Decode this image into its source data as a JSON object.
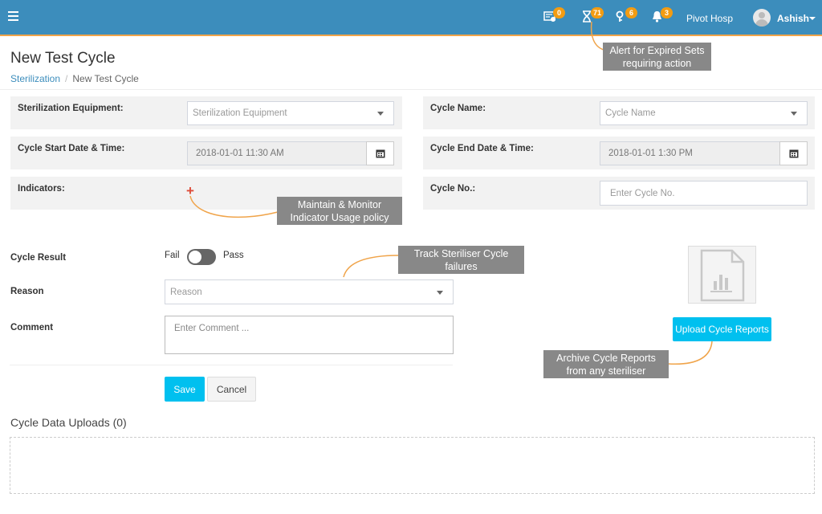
{
  "nav": {
    "badges": {
      "tasks": "0",
      "expired": "71",
      "keys": "6",
      "alerts": "3"
    },
    "org_name": "Pivot Hosp",
    "user_name": "Ashish"
  },
  "page": {
    "title": "New Test Cycle",
    "breadcrumb": {
      "parent": "Sterilization",
      "current": "New Test Cycle"
    }
  },
  "form": {
    "equipment": {
      "label": "Sterilization Equipment:",
      "placeholder": "Sterilization Equipment"
    },
    "cycle_name": {
      "label": "Cycle Name:",
      "placeholder": "Cycle Name"
    },
    "start": {
      "label": "Cycle Start Date & Time:",
      "value": "2018-01-01 11:30 AM"
    },
    "end": {
      "label": "Cycle End Date & Time:",
      "value": "2018-01-01 1:30 PM"
    },
    "indicators": {
      "label": "Indicators:",
      "add_symbol": "+"
    },
    "cycle_no": {
      "label": "Cycle No.:",
      "placeholder": "Enter Cycle No."
    },
    "result": {
      "label": "Cycle Result",
      "off_text": "Fail",
      "on_text": "Pass",
      "is_pass": false
    },
    "reason": {
      "label": "Reason",
      "placeholder": "Reason"
    },
    "comment": {
      "label": "Comment",
      "placeholder": "Enter Comment ..."
    },
    "save_label": "Save",
    "cancel_label": "Cancel"
  },
  "uploads": {
    "title": "Cycle Data Uploads (0)",
    "upload_label": "Upload Cycle Reports"
  },
  "callouts": {
    "expired": "Alert for Expired Sets requiring action",
    "indicator": "Maintain & Monitor Indicator Usage policy",
    "failures": "Track Steriliser Cycle failures",
    "archive": "Archive Cycle Reports from any steriliser"
  },
  "colors": {
    "topbar": "#3c8dbc",
    "accent": "#00c0ef",
    "badge": "#f39c12",
    "callout": "#888888",
    "connector": "#f0a44a",
    "add_icon": "#dd4b39"
  },
  "icons": {
    "menu": "hamburger-icon",
    "tasks": "task-list-icon",
    "expired": "hourglass-icon",
    "keys": "keys-icon",
    "alerts": "bell-icon",
    "calendar": "calendar-icon",
    "file": "chart-file-icon"
  }
}
